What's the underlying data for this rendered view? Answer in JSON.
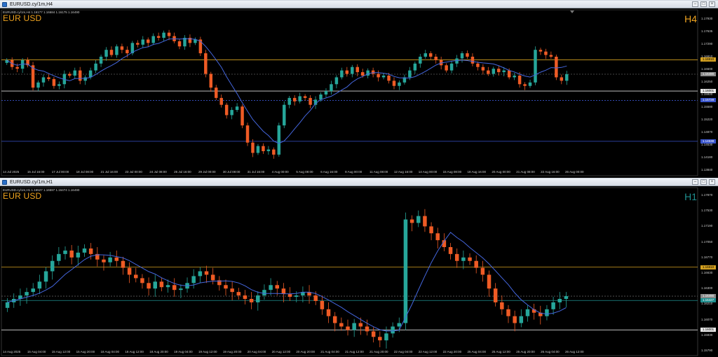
{
  "colors": {
    "bull": "#26a69a",
    "bear": "#ef5b25",
    "ma": "#4466dd",
    "hline_orange": "#d4a020",
    "hline_white": "#d8d8d8",
    "hline_blue": "#3a55cc",
    "hline_grey": "#5a5a5a",
    "symbol": "#f0a420",
    "tf_h4": "#f0a420",
    "tf_h1": "#1f8f8f"
  },
  "icons": {
    "app": "chart-window-icon",
    "minimize": "minimize-icon",
    "maximize": "maximize-icon",
    "close": "close-icon"
  },
  "top": {
    "window_title": "EURUSD.cy/1m,H4",
    "ohlc_text": "EURUSD.cy/1m,H4 1.16177 1.16684 1.16175 1.16490",
    "symbol": "EUR USD",
    "timeframe": "H4",
    "price_ticks": [
      "1.17930",
      "1.17635",
      "1.17290",
      "1.16910",
      "1.16600",
      "1.16250",
      "1.15920",
      "1.15580",
      "1.15220",
      "1.14870",
      "1.14530",
      "1.14180",
      "1.13840"
    ],
    "price_tags": [
      {
        "text": "1.16910",
        "kind": "orange",
        "value": 1.1691
      },
      {
        "text": "1.16490",
        "kind": "grey",
        "value": 1.1649
      },
      {
        "text": "1.16001",
        "kind": "white",
        "value": 1.16001
      },
      {
        "text": "1.15728",
        "kind": "blue",
        "value": 1.15728
      },
      {
        "text": "1.14538",
        "kind": "blue",
        "value": 1.14538
      }
    ],
    "time_ticks": [
      "14 Jul 2025",
      "15 Jul 16:00",
      "17 Jul 00:00",
      "18 Jul 08:00",
      "21 Jul 16:00",
      "23 Jul 00:00",
      "24 Jul 08:00",
      "25 Jul 16:00",
      "29 Jul 00:00",
      "30 Jul 08:00",
      "31 Jul 16:00",
      "4 Aug 00:00",
      "5 Aug 08:00",
      "6 Aug 16:00",
      "8 Aug 00:00",
      "11 Aug 08:00",
      "12 Aug 16:00",
      "14 Aug 00:00",
      "15 Aug 08:00",
      "18 Aug 16:00",
      "20 Aug 00:00",
      "21 Aug 08:00",
      "22 Aug 16:00",
      "26 Aug 00:00"
    ]
  },
  "bottom": {
    "window_title": "EURUSD.cy/1m,H1",
    "ohlc_text": "EURUSD.cy/1m,H1 1.16527 1.16597 1.16474 1.16490",
    "symbol": "EUR USD",
    "timeframe": "H1",
    "price_ticks": [
      "1.17870",
      "1.17530",
      "1.17190",
      "1.17050",
      "1.16770",
      "1.16630",
      "1.16300",
      "1.16210",
      "1.16070",
      "1.15930",
      "1.15790"
    ],
    "price_tags": [
      {
        "text": "1.16910",
        "kind": "orange",
        "value": 1.1691
      },
      {
        "text": "1.16490",
        "kind": "grey",
        "value": 1.1649
      },
      {
        "text": "1.16427",
        "kind": "teal",
        "value": 1.16427
      },
      {
        "text": "1.16001",
        "kind": "white",
        "value": 1.16001
      }
    ],
    "time_ticks": [
      "14 Aug 2025",
      "15 Aug 04:00",
      "15 Aug 12:00",
      "15 Aug 20:00",
      "18 Aug 04:00",
      "18 Aug 12:00",
      "18 Aug 20:00",
      "19 Aug 04:00",
      "19 Aug 12:00",
      "19 Aug 20:00",
      "20 Aug 04:00",
      "20 Aug 12:00",
      "20 Aug 20:00",
      "21 Aug 04:00",
      "21 Aug 12:00",
      "21 Aug 20:00",
      "22 Aug 04:00",
      "22 Aug 12:00",
      "22 Aug 20:00",
      "25 Aug 04:00",
      "25 Aug 12:00",
      "25 Aug 20:00",
      "26 Aug 04:00",
      "26 Aug 12:00"
    ]
  },
  "chart_data": [
    {
      "type": "candlestick",
      "symbol": "EUR USD",
      "timeframe": "H4",
      "ylim": [
        1.137,
        1.181
      ],
      "hlines": [
        1.1691,
        1.1649,
        1.16001,
        1.15728,
        1.14538
      ],
      "series_close": [
        1.169,
        1.167,
        1.1665,
        1.169,
        1.1675,
        1.161,
        1.1625,
        1.164,
        1.1635,
        1.1615,
        1.162,
        1.165,
        1.1645,
        1.166,
        1.163,
        1.164,
        1.166,
        1.168,
        1.17,
        1.172,
        1.1705,
        1.173,
        1.172,
        1.171,
        1.174,
        1.1735,
        1.175,
        1.174,
        1.176,
        1.1755,
        1.177,
        1.176,
        1.1745,
        1.173,
        1.1755,
        1.174,
        1.175,
        1.171,
        1.165,
        1.161,
        1.158,
        1.156,
        1.153,
        1.1545,
        1.1555,
        1.15,
        1.145,
        1.142,
        1.144,
        1.1425,
        1.143,
        1.1415,
        1.15,
        1.156,
        1.158,
        1.157,
        1.1585,
        1.158,
        1.156,
        1.1575,
        1.159,
        1.16,
        1.162,
        1.164,
        1.166,
        1.165,
        1.167,
        1.1655,
        1.1645,
        1.166,
        1.165,
        1.164,
        1.1645,
        1.163,
        1.1615,
        1.1625,
        1.164,
        1.166,
        1.168,
        1.17,
        1.171,
        1.17,
        1.169,
        1.1675,
        1.166,
        1.168,
        1.1695,
        1.171,
        1.17,
        1.168,
        1.167,
        1.166,
        1.165,
        1.1665,
        1.1655,
        1.166,
        1.164,
        1.1645,
        1.162,
        1.1615,
        1.1625,
        1.172,
        1.1715,
        1.1705,
        1.17,
        1.164,
        1.163,
        1.1649
      ]
    },
    {
      "type": "candlestick",
      "symbol": "EUR USD",
      "timeframe": "H1",
      "ylim": [
        1.157,
        1.1795
      ],
      "hlines": [
        1.1691,
        1.1649,
        1.16427,
        1.16001
      ],
      "series_close": [
        1.164,
        1.1645,
        1.165,
        1.1655,
        1.166,
        1.167,
        1.1685,
        1.17,
        1.171,
        1.1715,
        1.1705,
        1.1712,
        1.1718,
        1.171,
        1.1702,
        1.1698,
        1.1705,
        1.17,
        1.169,
        1.168,
        1.1675,
        1.1668,
        1.166,
        1.167,
        1.1662,
        1.1665,
        1.1658,
        1.166,
        1.1668,
        1.1678,
        1.1685,
        1.168,
        1.1672,
        1.1665,
        1.166,
        1.1655,
        1.165,
        1.1645,
        1.164,
        1.165,
        1.1658,
        1.1665,
        1.166,
        1.1652,
        1.1648,
        1.165,
        1.1655,
        1.165,
        1.1642,
        1.163,
        1.162,
        1.161,
        1.1605,
        1.16,
        1.161,
        1.1605,
        1.1598,
        1.159,
        1.1585,
        1.1595,
        1.1605,
        1.161,
        1.176,
        1.1755,
        1.1765,
        1.175,
        1.174,
        1.173,
        1.172,
        1.171,
        1.17,
        1.1705,
        1.17,
        1.169,
        1.168,
        1.166,
        1.164,
        1.163,
        1.162,
        1.161,
        1.162,
        1.163,
        1.1625,
        1.162,
        1.163,
        1.164,
        1.1645,
        1.1649
      ]
    }
  ]
}
